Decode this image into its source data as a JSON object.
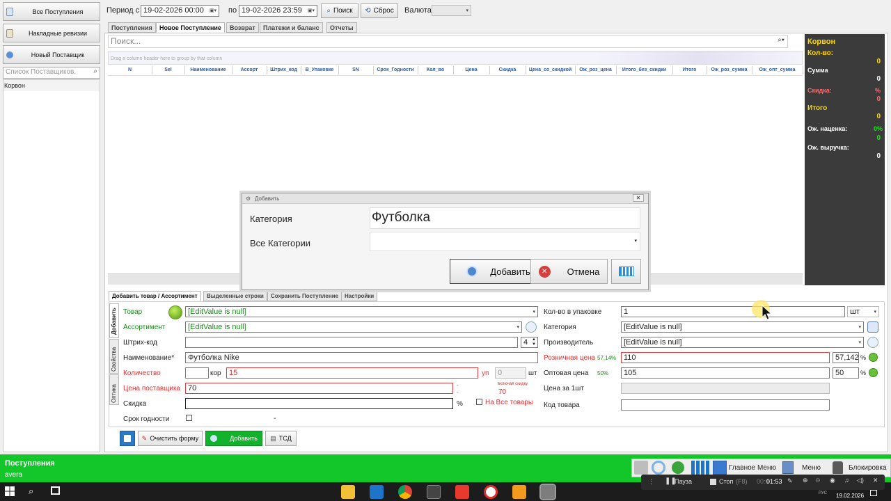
{
  "left_nav": {
    "all_receipts": "Все Поступления",
    "invoice_audits": "Накладные ревизии",
    "new_supplier": "Новый Поставщик",
    "supplier_search_placeholder": "Список Поставщиков.",
    "suppliers": [
      "Корвон"
    ]
  },
  "filter": {
    "period_from_label": "Период с",
    "date_from": "19-02-2026 00:00",
    "to_label": "по",
    "date_to": "19-02-2026 23:59",
    "search_button": "Поиск",
    "reset_button": "Сброс",
    "currency_label": "Валюта",
    "currency_value": ""
  },
  "top_tabs": [
    "Поступления",
    "Новое Поступление",
    "Возврат",
    "Платежи и баланс",
    "Отчеты"
  ],
  "grid": {
    "search_placeholder": "Поиск...",
    "group_hint": "Drag a column header here to group by that column",
    "columns": [
      "N",
      "Sel",
      "Наименование",
      "Ассорт",
      "Штрих_код",
      "В_Упаковке",
      "SN",
      "Срок_Годности",
      "Кол_во",
      "Цена",
      "Скидка",
      "Цена_со_скидкой",
      "Ож_роз_цена",
      "Итого_без_скидки",
      "Итого",
      "Ож_роз_сумма",
      "Ож_опт_сумма"
    ]
  },
  "summary": {
    "supplier": "Корвон",
    "qty_label": "Кол-во:",
    "qty_value": "0",
    "sum_label": "Сумма",
    "sum_value": "0",
    "discount_label": "Скидка:",
    "discount_pct": "%",
    "discount_value": "0",
    "total_label": "Итого",
    "total_value": "0",
    "markup_label": "Ож. наценка:",
    "markup_pct": "0%",
    "markup_value": "0",
    "revenue_label": "Ож. выручка:",
    "revenue_value": "0"
  },
  "dialog": {
    "title": "Добавить",
    "category_label": "Категория",
    "category_value": "Футболка",
    "all_categories_label": "Все Категории",
    "all_categories_value": "",
    "add_button": "Добавить",
    "cancel_button": "Отмена"
  },
  "bottom_tabs": [
    "Добавить товар / Ассортимент",
    "Выделенные строки",
    "Сохранить Поступление",
    "Настройки"
  ],
  "vtabs": [
    "Добавить",
    "Свойства",
    "Оптика"
  ],
  "form": {
    "product_label": "Товар",
    "product_value": "[EditValue is null]",
    "assortment_label": "Ассортимент",
    "assortment_value": "[EditValue is null]",
    "barcode_label": "Штрих-код",
    "barcode_value": "",
    "barcode_spin": "4",
    "name_label": "Наименование*",
    "name_value": "Футболка Nike",
    "qty_label": "Количество",
    "qty_box": "",
    "qty_box_unit": "кор",
    "qty_value": "15",
    "qty_pack_unit": "уп",
    "qty_pieces": "0",
    "qty_pieces_unit": "шт",
    "supplier_price_label": "Цена поставщика",
    "supplier_price_value": "70",
    "price_dash1": "-",
    "price_dash2": "-",
    "incl_discount_label": "включая скидку",
    "incl_discount_value": "70",
    "discount_label": "Скидка",
    "discount_value": "",
    "discount_unit": "%",
    "all_goods_label": "На Все товары",
    "expiry_label": "Срок годности",
    "expiry_dash": "-",
    "pack_qty_label": "Кол-во в упаковке",
    "pack_qty_value": "1",
    "pack_unit": "шт",
    "category_label": "Категория",
    "category_value": "[EditValue is null]",
    "manufacturer_label": "Производитель",
    "manufacturer_value": "[EditValue is null]",
    "retail_label": "Розничная цена",
    "retail_pct": "57,14%",
    "retail_value": "110",
    "retail_markup": "57,142",
    "pct_sign": "%",
    "wholesale_label": "Оптовая цена",
    "wholesale_pct": "50%",
    "wholesale_value": "105",
    "wholesale_markup": "50",
    "unit_price_label": "Цена за 1шт",
    "unit_price_value": "",
    "code_label": "Код товара",
    "code_value": ""
  },
  "actions": {
    "clear": "Очистить форму",
    "add": "Добавить",
    "tsd": "ТСД"
  },
  "status": {
    "title": "Поступления",
    "user": "avera",
    "main_menu": "Главное Меню",
    "menu": "Меню",
    "lock": "Блокировка"
  },
  "recorder": {
    "pause": "Пауза",
    "stop": "Стоп",
    "stop_key": "(F8)",
    "time_dim": "00:0",
    "time": "01:53"
  },
  "taskbar": {
    "lang": "РУС",
    "date": "19.02.2026"
  }
}
